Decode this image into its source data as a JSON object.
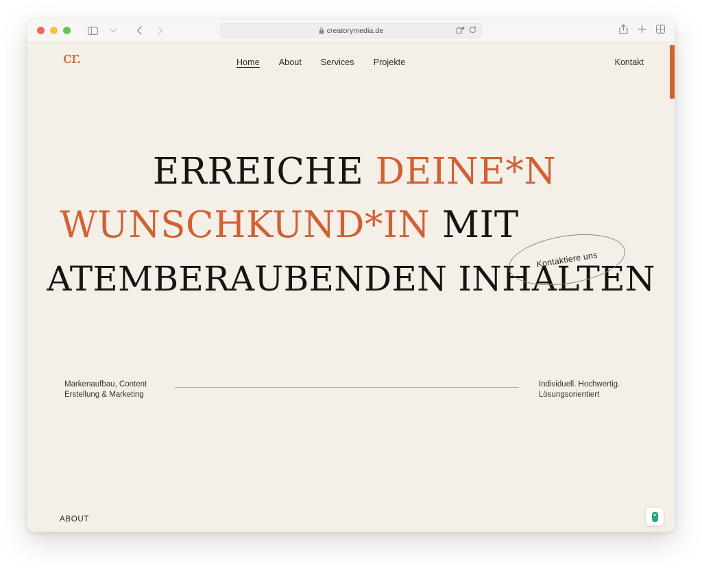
{
  "browser": {
    "traffic_lights": [
      "close",
      "minimize",
      "maximize"
    ],
    "sidebar_toggle_icon": "sidebar-icon",
    "tab_group_icon": "chevron-down-icon",
    "back_icon": "chevron-left-icon",
    "forward_icon": "chevron-right-icon",
    "reader_icon": "reader-contrast-icon",
    "url": "creatorymedia.de",
    "url_lock_icon": "lock-icon",
    "extension_icon": "puzzle-extension-icon",
    "reload_icon": "reload-icon",
    "share_icon": "share-icon",
    "new_tab_icon": "plus-icon",
    "tab_overview_icon": "tab-overview-icon"
  },
  "site": {
    "logo_text": "cr.",
    "nav": [
      {
        "label": "Home",
        "active": true
      },
      {
        "label": "About",
        "active": false
      },
      {
        "label": "Services",
        "active": false
      },
      {
        "label": "Projekte",
        "active": false
      }
    ],
    "contact_link": "Kontakt",
    "hero": {
      "line1_dark": "ERREICHE",
      "line1_accent": "DEINE*N",
      "line2_accent": "WUNSCHKUND*IN",
      "line2_dark": "MIT",
      "line3": "ATEMBERAUBENDEN  INHALTEN"
    },
    "badge_label": "Kontaktiere uns",
    "sub_left_line1": "Markenaufbau, Content",
    "sub_left_line2": "Erstellung & Marketing",
    "sub_right_line1": "Individuell. Hochwertig.",
    "sub_right_line2": "Lösungsorientiert",
    "about_label": "ABOUT",
    "privacy_widget_icon": "privacy-shield-icon"
  },
  "colors": {
    "accent": "#cf6134",
    "page_background": "#f4efe7",
    "text_dark": "#171513",
    "scrollbar_thumb": "#d4622e",
    "privacy_green": "#2aa87c"
  }
}
